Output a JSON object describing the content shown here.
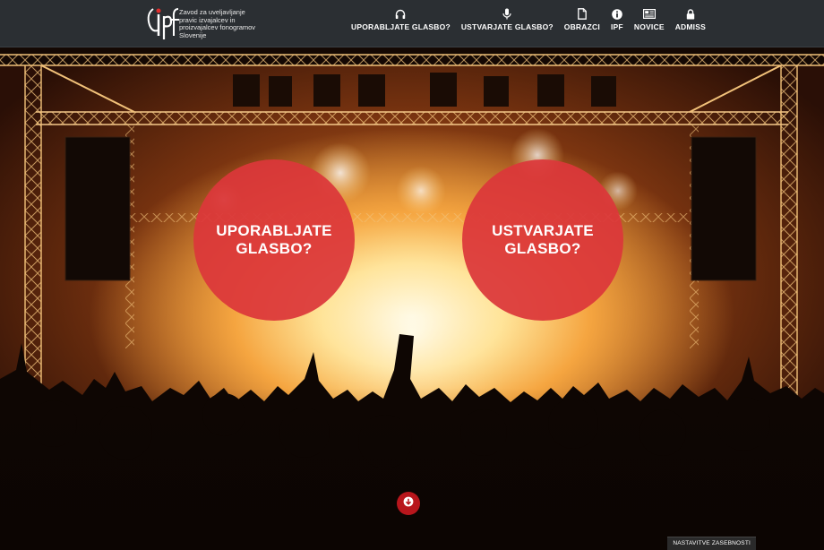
{
  "brand": {
    "logo_alt": "IPF",
    "tagline": "Zavod za uveljavljanje pravic izvajalcev in proizvajalcev fonogramov Slovenije"
  },
  "nav": {
    "items": [
      {
        "label": "UPORABLJATE GLASBO?",
        "icon": "headphones-icon"
      },
      {
        "label": "USTVARJATE GLASBO?",
        "icon": "microphone-icon"
      },
      {
        "label": "OBRAZCI",
        "icon": "document-icon"
      },
      {
        "label": "IPF",
        "icon": "info-icon"
      },
      {
        "label": "NOVICE",
        "icon": "newspaper-icon"
      },
      {
        "label": "ADMISS",
        "icon": "lock-icon"
      }
    ]
  },
  "hero": {
    "circle_left": "UPORABLJATE\nGLASBO?",
    "circle_right": "USTVARJATE\nGLASBO?",
    "circle_color": "#db373a",
    "scroll_icon": "arrow-down-icon"
  },
  "footer": {
    "privacy_label": "NASTAVITVE ZASEBNOSTI"
  },
  "colors": {
    "header_bg": "#2b2f33",
    "accent_red": "#db373a"
  }
}
